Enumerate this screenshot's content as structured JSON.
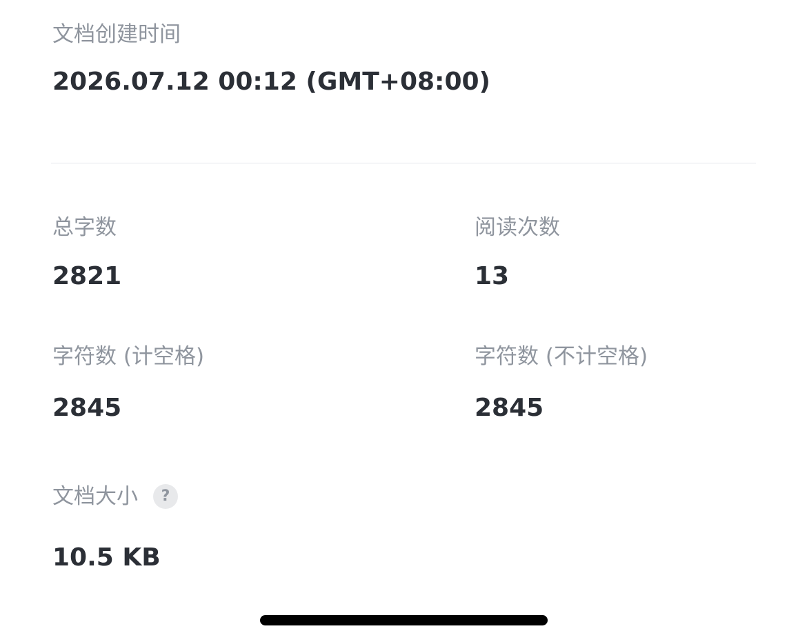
{
  "creation": {
    "label": "文档创建时间",
    "value": "2026.07.12 00:12 (GMT+08:00)"
  },
  "stats": {
    "total_words": {
      "label": "总字数",
      "value": "2821"
    },
    "read_count": {
      "label": "阅读次数",
      "value": "13"
    },
    "chars_with_spaces": {
      "label": "字符数 (计空格)",
      "value": "2845"
    },
    "chars_without_spaces": {
      "label": "字符数 (不计空格)",
      "value": "2845"
    },
    "doc_size": {
      "label": "文档大小",
      "value": "10.5 KB",
      "help_icon": "question-circle-icon",
      "help_glyph": "?"
    }
  },
  "colors": {
    "label": "#8f959e",
    "value": "#2b2f36",
    "divider": "#e6e8eb",
    "background": "#ffffff"
  }
}
